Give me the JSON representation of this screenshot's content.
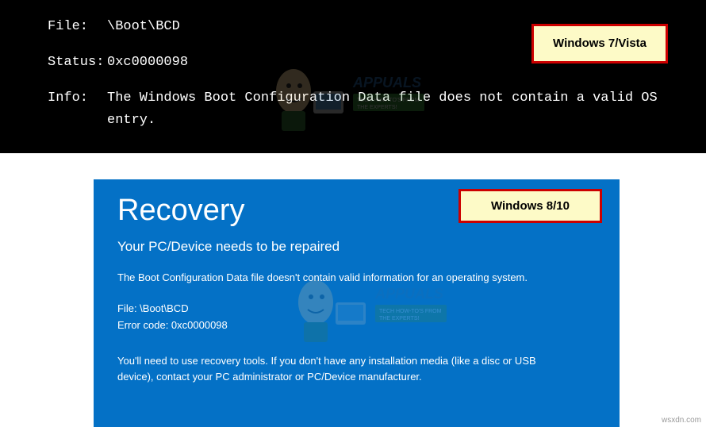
{
  "top_screen": {
    "file_label": "File:",
    "file_value": "\\Boot\\BCD",
    "status_label": "Status:",
    "status_value": "0xc0000098",
    "info_label": "Info:",
    "info_value": "The Windows Boot Configuration Data file does not contain a valid OS entry.",
    "os_label": "Windows 7/Vista"
  },
  "bottom_screen": {
    "title": "Recovery",
    "subtitle": "Your PC/Device needs to be repaired",
    "description": "The Boot Configuration Data file doesn't contain valid information for an operating system.",
    "file_line": "File: \\Boot\\BCD",
    "error_line": "Error code: 0xc0000098",
    "instructions": "You'll need to use recovery tools. If you don't have any installation media (like a disc or USB device), contact your PC administrator or PC/Device manufacturer.",
    "os_label": "Windows 8/10"
  },
  "watermark": {
    "brand": "APPUALS",
    "tagline": "TECH HOW-TO'S FROM THE EXPERTS!"
  },
  "attribution": "wsxdn.com"
}
